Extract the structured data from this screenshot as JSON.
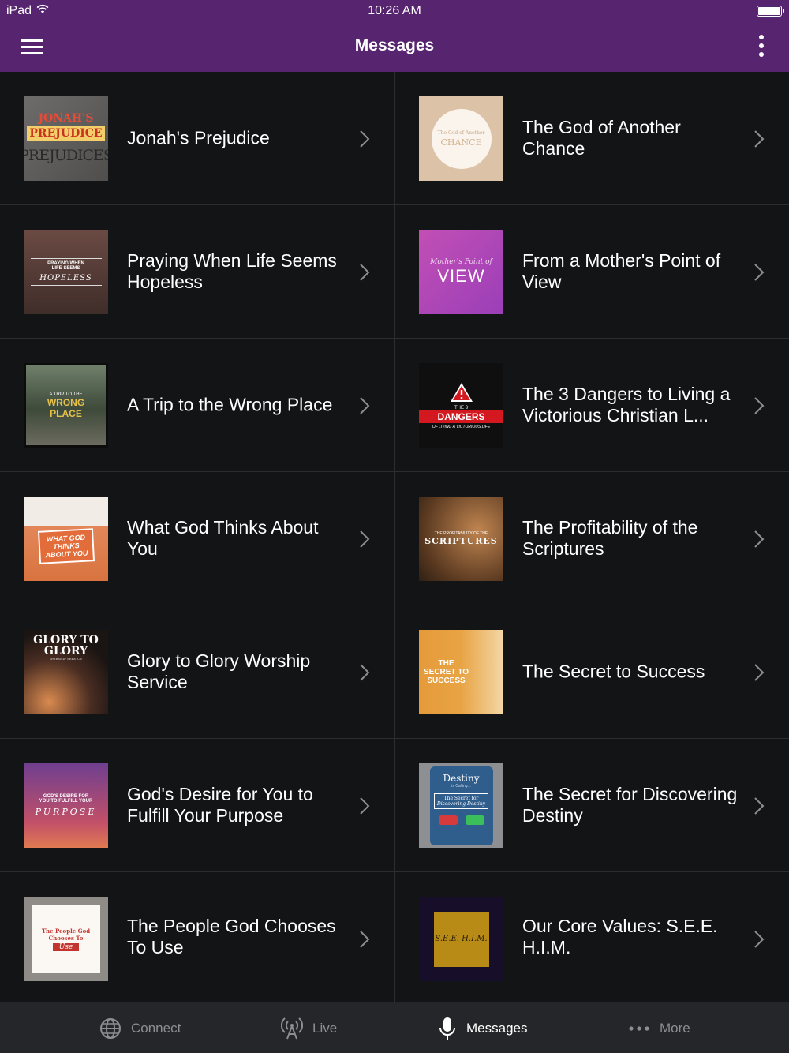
{
  "status": {
    "device": "iPad",
    "time": "10:26 AM"
  },
  "header": {
    "title": "Messages"
  },
  "messages": [
    {
      "title": "Jonah's Prejudice",
      "thumb_lines": [
        "JONAH'S",
        "PREJUDICE",
        "PREJUDICES"
      ]
    },
    {
      "title": "The God of Another Chance",
      "thumb_lines": [
        "The God of Another",
        "CHANCE"
      ]
    },
    {
      "title": "Praying When Life Seems Hopeless",
      "thumb_lines": [
        "PRAYING WHEN",
        "LIFE SEEMS",
        "HOPELESS"
      ]
    },
    {
      "title": "From a Mother's Point of View",
      "thumb_lines": [
        "Mother's Point of",
        "VIEW"
      ]
    },
    {
      "title": "A Trip to the Wrong Place",
      "thumb_lines": [
        "A TRIP TO THE",
        "WRONG",
        "PLACE"
      ]
    },
    {
      "title": "The 3 Dangers to Living a Victorious Christian L...",
      "thumb_lines": [
        "THE 3",
        "DANGERS",
        "OF LIVING A VICTORIOUS LIFE"
      ]
    },
    {
      "title": "What God Thinks About You",
      "thumb_lines": [
        "WHAT GOD",
        "THINKS",
        "ABOUT YOU"
      ]
    },
    {
      "title": "The Profitability of the Scriptures",
      "thumb_lines": [
        "THE PROFITABILITY OF THE",
        "SCRIPTURES"
      ]
    },
    {
      "title": "Glory to Glory Worship Service",
      "thumb_lines": [
        "GLORY TO",
        "GLORY",
        "WORSHIP SERVICE"
      ]
    },
    {
      "title": "The Secret to Success",
      "thumb_lines": [
        "THE",
        "SECRET TO",
        "SUCCESS"
      ]
    },
    {
      "title": "God's Desire for You to Fulfill Your Purpose",
      "thumb_lines": [
        "GOD'S DESIRE FOR",
        "YOU TO FULFILL YOUR",
        "PURPOSE"
      ]
    },
    {
      "title": "The Secret for Discovering Destiny",
      "thumb_lines": [
        "Destiny",
        "is Calling...",
        "The Secret for",
        "Discovering Destiny"
      ]
    },
    {
      "title": "The People God Chooses To Use",
      "thumb_lines": [
        "The People God",
        "Chooses To",
        "Use"
      ]
    },
    {
      "title": "Our Core Values: S.E.E. H.I.M.",
      "thumb_lines": [
        "S.E.E. H.I.M."
      ]
    }
  ],
  "tabs": [
    {
      "label": "Connect",
      "icon": "globe-icon",
      "active": false
    },
    {
      "label": "Live",
      "icon": "broadcast-icon",
      "active": false
    },
    {
      "label": "Messages",
      "icon": "microphone-icon",
      "active": true
    },
    {
      "label": "More",
      "icon": "ellipsis-icon",
      "active": false
    }
  ],
  "colors": {
    "accent": "#57256f",
    "background": "#131416",
    "tab_bar": "#25262a",
    "inactive": "#8d8e92"
  }
}
